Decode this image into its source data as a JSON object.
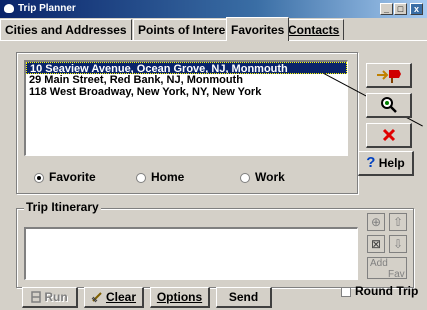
{
  "window": {
    "title": "Trip Planner",
    "controls": {
      "minimize": "_",
      "maximize": "□",
      "close": "x"
    }
  },
  "tabs": [
    {
      "label": "Cities and Addresses",
      "active": false
    },
    {
      "label": "Points of Interest",
      "active": false
    },
    {
      "label": "Favorites",
      "active": true
    },
    {
      "label": "Contacts",
      "active": false
    }
  ],
  "favorites": {
    "items": [
      {
        "text": "10 Seaview Avenue, Ocean Grove, NJ, Monmouth",
        "selected": true
      },
      {
        "text": "29 Main Street, Red Bank, NJ, Monmouth",
        "selected": false
      },
      {
        "text": "118 West Broadway, New York, NY, New York",
        "selected": false
      }
    ],
    "radios": [
      {
        "label": "Favorite",
        "checked": true
      },
      {
        "label": "Home",
        "checked": false
      },
      {
        "label": "Work",
        "checked": false
      }
    ],
    "side_buttons": {
      "add_favorite_icon": "add-favorite-icon",
      "find_icon": "magnifier-icon",
      "delete_icon": "red-x-icon",
      "help_label": "Help",
      "help_glyph": "?"
    }
  },
  "itinerary": {
    "legend": "Trip Itinerary",
    "small_buttons": {
      "zoom": "⊕",
      "up": "⇧",
      "clear": "⊠",
      "down": "⇩",
      "add_fav_label": "Add",
      "add_fav_sub": "Fav"
    },
    "round_trip_label": "Round Trip"
  },
  "bottom_buttons": {
    "run": "Run",
    "clear": "Clear",
    "options": "Options",
    "send": "Send"
  }
}
